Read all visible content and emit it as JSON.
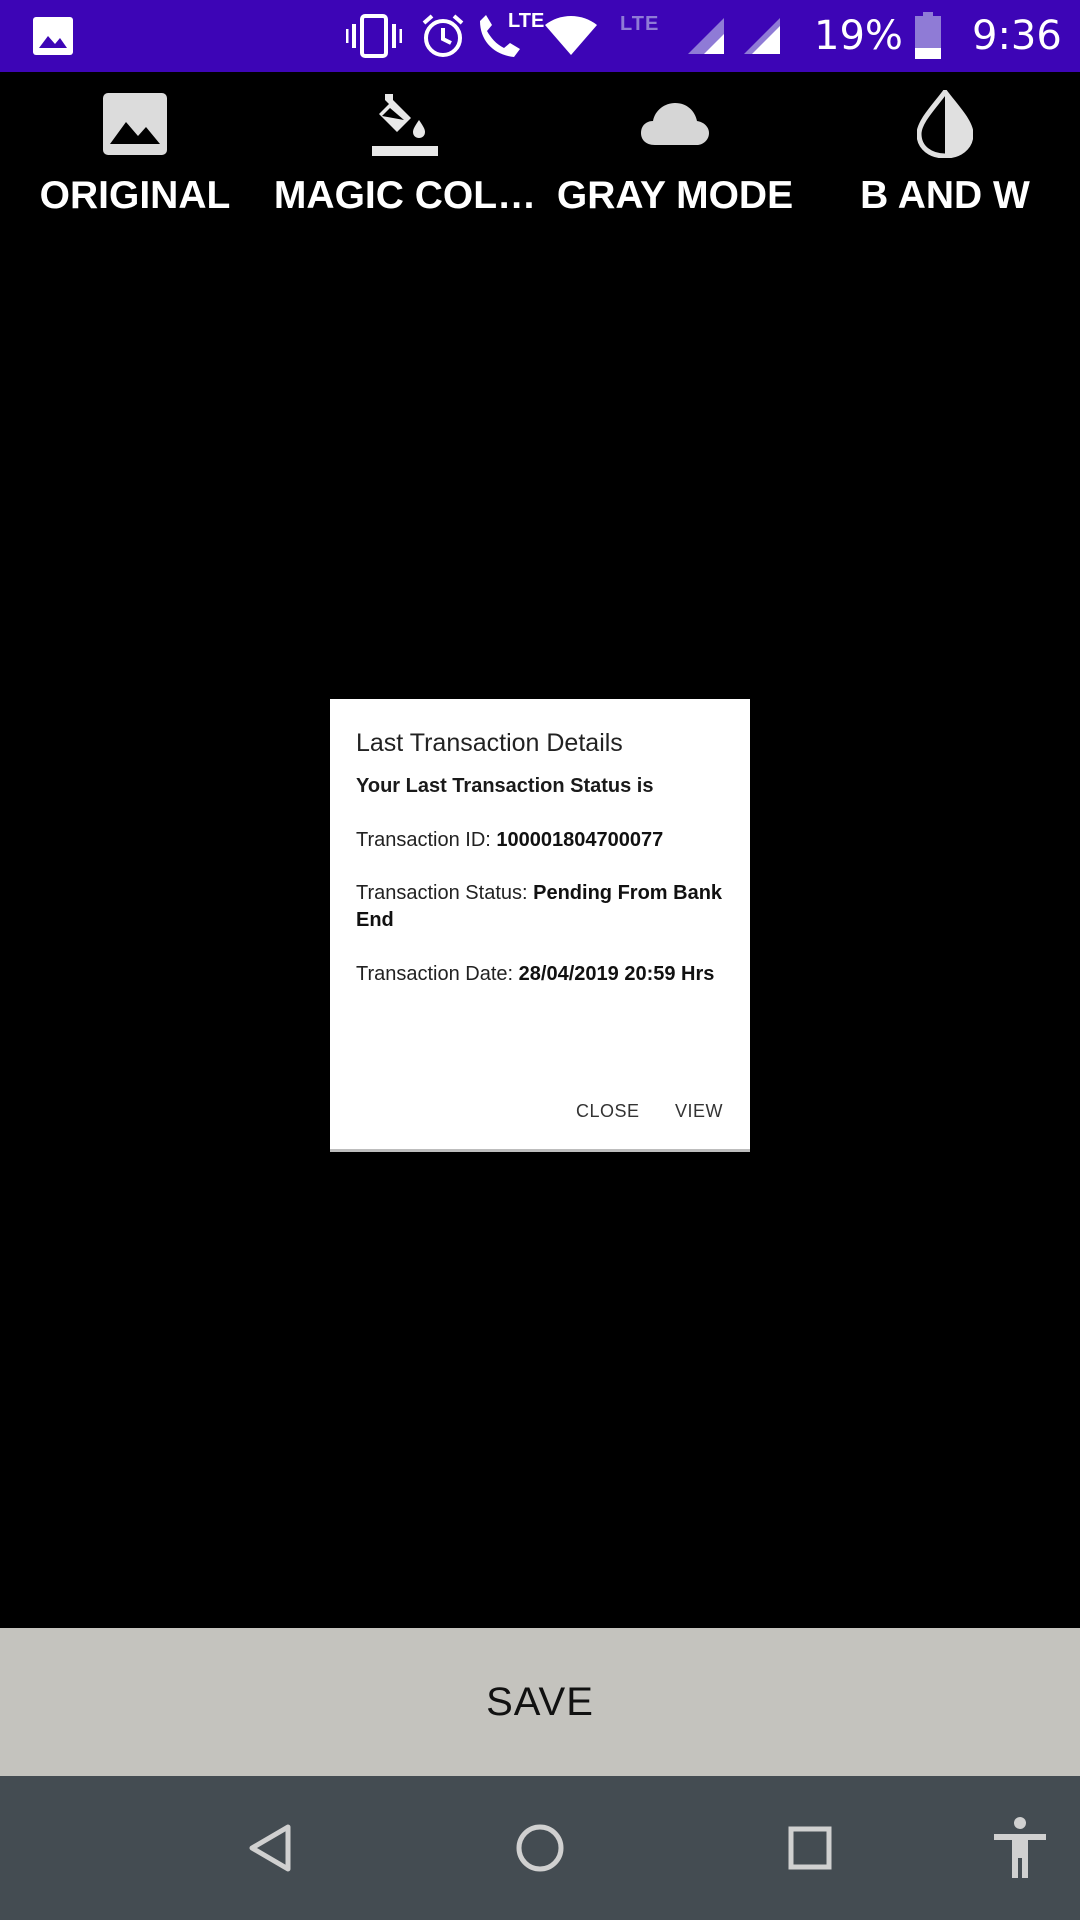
{
  "status_bar": {
    "lte_small": "LTE",
    "call_lte": "LTE",
    "battery": "19%",
    "time": "9:36"
  },
  "filters": [
    {
      "label": "ORIGINAL",
      "icon": "image-icon"
    },
    {
      "label": "MAGIC COL…",
      "icon": "paint-bucket-icon"
    },
    {
      "label": "GRAY MODE",
      "icon": "cloud-icon"
    },
    {
      "label": "B AND W",
      "icon": "contrast-drop-icon"
    }
  ],
  "document": {
    "title": "Last Transaction Details",
    "subtitle": "Your Last Transaction Status is",
    "id_label": "Transaction ID: ",
    "id_value": "100001804700077",
    "status_label": "Transaction Status: ",
    "status_value": "Pending From Bank End",
    "date_label": "Transaction Date: ",
    "date_value": "28/04/2019 20:59 Hrs",
    "close_label": "CLOSE",
    "view_label": "VIEW"
  },
  "save_label": "SAVE",
  "nav": [
    "back-icon",
    "home-icon",
    "recents-icon",
    "accessibility-icon"
  ],
  "colors": {
    "status_bar": "#3d05b6",
    "save_bar": "#c4c3be",
    "nav_bar": "#444c52"
  }
}
